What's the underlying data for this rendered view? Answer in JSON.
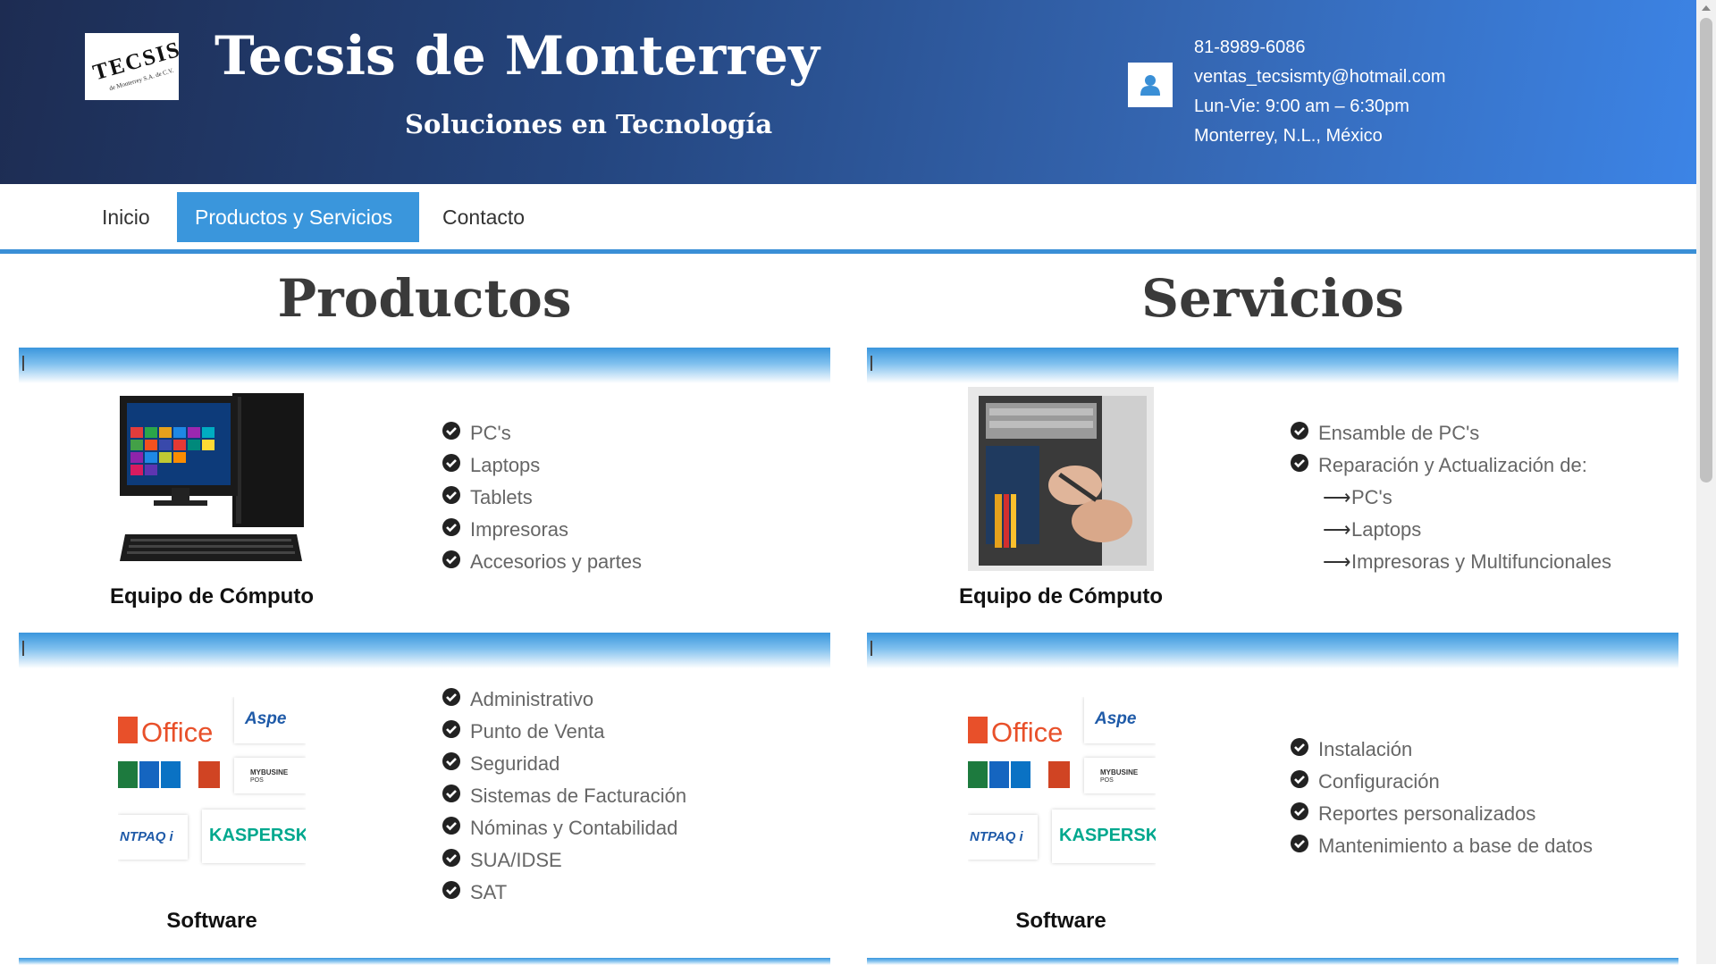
{
  "header": {
    "logo_text": "TECSIS",
    "logo_subtext": "de Monterrey S.A. de C.V.",
    "title": "Tecsis de Monterrey",
    "tagline": "Soluciones en Tecnología",
    "contact": {
      "phone": "81-8989-6086",
      "email": "ventas_tecsismty@hotmail.com",
      "hours": "Lun-Vie: 9:00 am – 6:30pm",
      "location": "Monterrey, N.L., México",
      "icon": "user-icon"
    }
  },
  "nav": {
    "items": [
      {
        "label": "Inicio"
      },
      {
        "label": "Productos y Servicios",
        "active": true
      },
      {
        "label": "Contacto"
      }
    ]
  },
  "productos": {
    "heading": "Productos",
    "blocks": [
      {
        "caption": "Equipo de Cómputo",
        "items": [
          "PC's",
          "Laptops",
          "Tablets",
          "Impresoras",
          "Accesorios y partes"
        ]
      },
      {
        "caption": "Software",
        "items": [
          "Administrativo",
          "Punto de Venta",
          "Seguridad",
          "Sistemas de Facturación",
          "Nóminas y Contabilidad",
          "SUA/IDSE",
          "SAT"
        ]
      }
    ]
  },
  "servicios": {
    "heading": "Servicios",
    "blocks": [
      {
        "caption": "Equipo de Cómputo",
        "items": [
          "Ensamble de PC's",
          "Reparación y Actualización de:"
        ],
        "subitems": [
          "PC's",
          "Laptops",
          "Impresoras y Multifuncionales"
        ]
      },
      {
        "caption": "Software",
        "items": [
          "Instalación",
          "Configuración",
          "Reportes personalizados",
          "Mantenimiento a base de datos"
        ]
      }
    ]
  },
  "software_logos": {
    "office": "Office",
    "aspel": "Aspe",
    "mybusiness_1": "MYBUSINE",
    "mybusiness_2": "POS",
    "contpaqi": "NTPAQ i",
    "kaspersky": "KASPERSKY"
  },
  "colors": {
    "accent": "#3a96dc",
    "header_dark": "#1d2c52",
    "header_light": "#3c84e6"
  }
}
